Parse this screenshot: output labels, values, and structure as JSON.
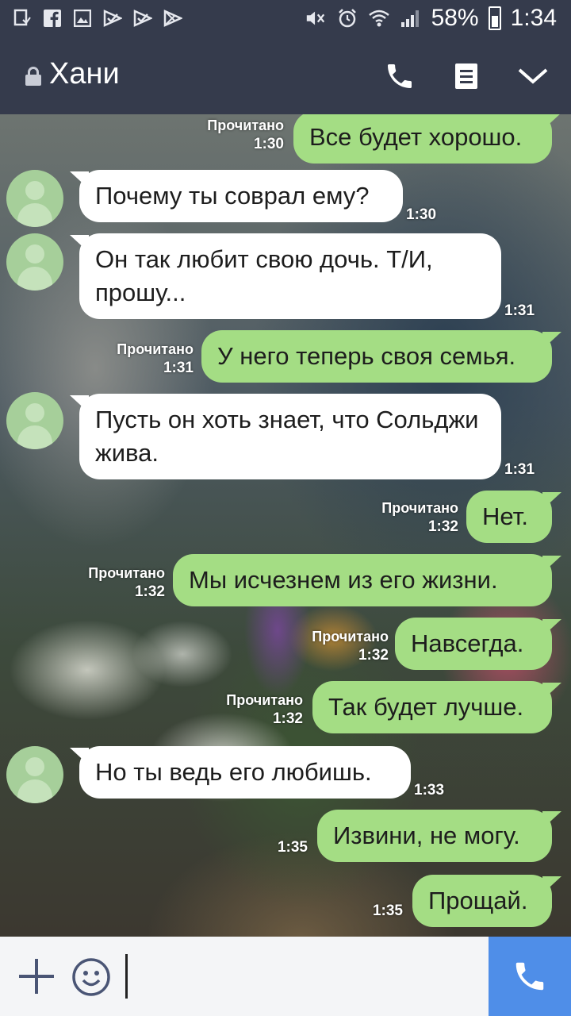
{
  "status_bar": {
    "battery": "58%",
    "time": "1:34",
    "left_icons": [
      "copy-icon",
      "facebook-icon",
      "image-icon",
      "check-flag-icon",
      "check-flag-icon",
      "play-store-icon"
    ],
    "right_icons": [
      "mute-icon",
      "alarm-icon",
      "wifi-icon",
      "signal-icon",
      "battery-icon"
    ]
  },
  "header": {
    "title": "Хани",
    "icons": [
      "lock-icon",
      "phone-icon",
      "notes-icon",
      "chevron-down-icon"
    ]
  },
  "messages": [
    {
      "side": "out",
      "text": "Все будет хорошо.",
      "read": "Прочитано",
      "time": "1:30"
    },
    {
      "side": "in",
      "text": "Почему ты соврал ему?",
      "time": "1:30"
    },
    {
      "side": "in",
      "text": "Он так любит свою дочь. Т/И, прошу...",
      "time": "1:31"
    },
    {
      "side": "out",
      "text": "У него теперь своя семья.",
      "read": "Прочитано",
      "time": "1:31"
    },
    {
      "side": "in",
      "text": "Пусть он хоть знает, что Сольджи жива.",
      "time": "1:31"
    },
    {
      "side": "out",
      "text": "Нет.",
      "read": "Прочитано",
      "time": "1:32"
    },
    {
      "side": "out",
      "text": "Мы исчезнем из его жизни.",
      "read": "Прочитано",
      "time": "1:32"
    },
    {
      "side": "out",
      "text": "Навсегда.",
      "read": "Прочитано",
      "time": "1:32"
    },
    {
      "side": "out",
      "text": "Так будет лучше.",
      "read": "Прочитано",
      "time": "1:32"
    },
    {
      "side": "in",
      "text": "Но ты ведь его любишь.",
      "time": "1:33"
    },
    {
      "side": "out",
      "text": "Извини, не могу.",
      "time": "1:35"
    },
    {
      "side": "out",
      "text": "Прощай.",
      "time": "1:35"
    }
  ],
  "input_bar": {
    "icons": [
      "plus-icon",
      "emoji-icon",
      "phone-icon"
    ],
    "value": ""
  },
  "colors": {
    "header_bg": "#353b4c",
    "outgoing_bubble": "#a4dd84",
    "incoming_bubble": "#ffffff",
    "call_button": "#4f8ee8"
  }
}
